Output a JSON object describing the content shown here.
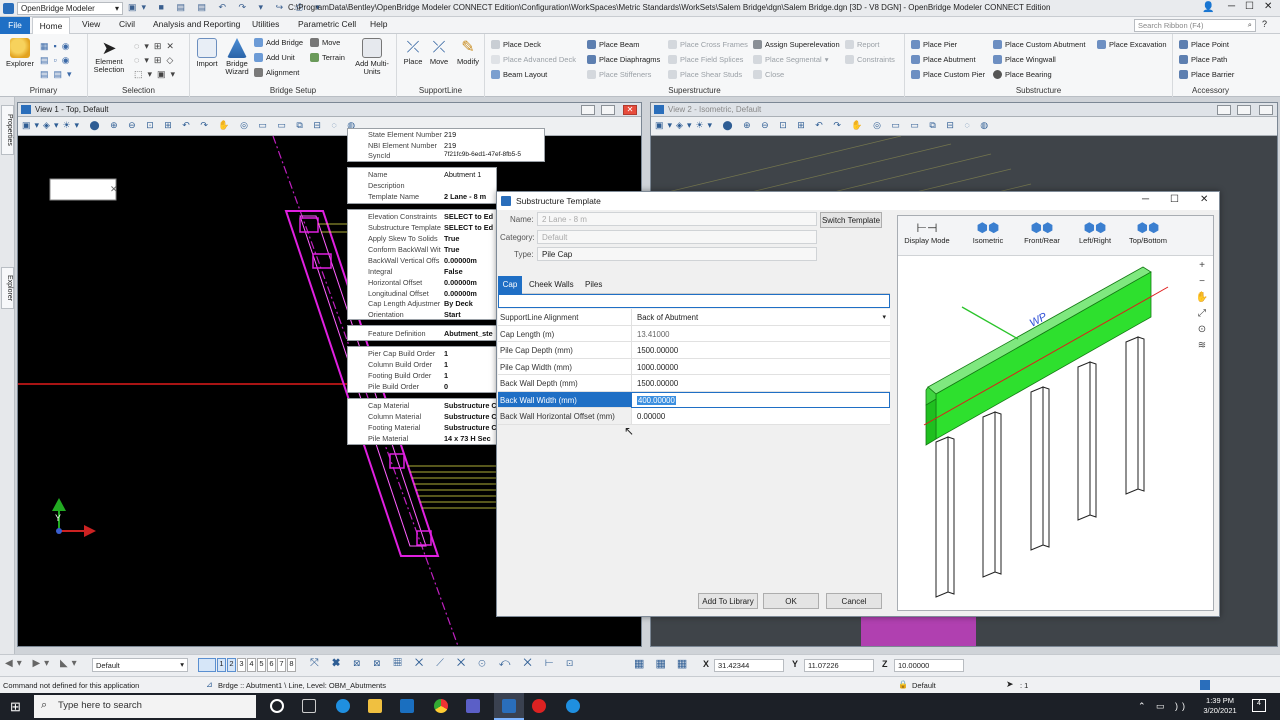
{
  "app": {
    "workflow": "OpenBridge Modeler",
    "title": "C:\\ProgramData\\Bentley\\OpenBridge Modeler CONNECT Edition\\Configuration\\WorkSpaces\\Metric Standards\\WorkSets\\Salem Bridge\\dgn\\Salem Bridge.dgn [3D - V8 DGN] - OpenBridge Modeler CONNECT Edition",
    "search_placeholder": "Search Ribbon (F4)"
  },
  "menu_tabs": [
    "File",
    "Home",
    "View",
    "Civil",
    "Analysis and Reporting",
    "Utilities",
    "Parametric Cell",
    "Help"
  ],
  "ribbon": {
    "primary": {
      "label": "Primary",
      "explorer": "Explorer"
    },
    "selection": {
      "label": "Selection",
      "element_selection": "Element Selection"
    },
    "bridge_setup": {
      "label": "Bridge Setup",
      "import": "Import",
      "bridge_wizard": "Bridge Wizard",
      "add_bridge": "Add Bridge",
      "add_unit": "Add Unit",
      "alignment": "Alignment",
      "move": "Move",
      "terrain": "Terrain",
      "add_multi_units": "Add Multi-Units"
    },
    "supportline": {
      "label": "SupportLine",
      "place": "Place",
      "move": "Move",
      "modify": "Modify"
    },
    "superstructure": {
      "label": "Superstructure",
      "place_deck": "Place Deck",
      "place_advanced_deck": "Place Advanced Deck",
      "beam_layout": "Beam Layout",
      "place_beam": "Place Beam",
      "place_diaphragms": "Place Diaphragms",
      "place_stiffeners": "Place Stiffeners",
      "place_cross_frames": "Place Cross Frames",
      "place_field_splices": "Place Field Splices",
      "place_shear_studs": "Place Shear Studs",
      "assign_superelevation": "Assign Superelevation",
      "place_segmental": "Place Segmental",
      "close": "Close",
      "report": "Report",
      "constraints": "Constraints"
    },
    "substructure": {
      "label": "Substructure",
      "place_pier": "Place Pier",
      "place_abutment": "Place Abutment",
      "place_custom_pier": "Place Custom Pier",
      "place_custom_abutment": "Place Custom Abutment",
      "place_wingwall": "Place Wingwall",
      "place_bearing": "Place Bearing",
      "place_excavation": "Place Excavation"
    },
    "accessory": {
      "label": "Accessory",
      "place_point": "Place Point",
      "place_path": "Place Path",
      "place_barrier": "Place Barrier"
    }
  },
  "side_tabs": [
    "Properties",
    "Explorer"
  ],
  "view1": {
    "title": "View 1 - Top, Default"
  },
  "view2": {
    "title": "View 2 - Isometric, Default"
  },
  "properties": {
    "group1": [
      [
        "State Element Number",
        "219"
      ],
      [
        "NBI Element Number",
        "219"
      ],
      [
        "SyncId",
        "7f21fc9b-6ed1-47ef-8fb5-5"
      ]
    ],
    "group2": [
      [
        "Name",
        "Abutment 1"
      ],
      [
        "Description",
        ""
      ],
      [
        "Template Name",
        "2 Lane - 8 m"
      ]
    ],
    "group3": [
      [
        "Elevation Constraints",
        "SELECT to Ed"
      ],
      [
        "Substructure Template",
        "SELECT to Ed"
      ],
      [
        "Apply Skew To Solids",
        "True"
      ],
      [
        "Conform BackWall Wit",
        "True"
      ],
      [
        "BackWall Vertical Offs",
        "0.00000m"
      ],
      [
        "Integral",
        "False"
      ],
      [
        "Horizontal Offset",
        "0.00000m"
      ],
      [
        "Longitudinal Offset",
        "0.00000m"
      ],
      [
        "Cap Length Adjustmer",
        "By Deck"
      ],
      [
        "Orientation",
        "Start"
      ]
    ],
    "group4": [
      [
        "Feature Definition",
        "Abutment_ste"
      ]
    ],
    "group5": [
      [
        "Pier Cap Build Order",
        "1"
      ],
      [
        "Column Build Order",
        "1"
      ],
      [
        "Footing Build Order",
        "1"
      ],
      [
        "Pile Build Order",
        "0"
      ]
    ],
    "group6": [
      [
        "Cap Material",
        "Substructure C"
      ],
      [
        "Column Material",
        "Substructure C"
      ],
      [
        "Footing Material",
        "Substructure C"
      ],
      [
        "Pile Material",
        "14 x 73 H Sec"
      ]
    ]
  },
  "dialog": {
    "title": "Substructure Template",
    "name_label": "Name:",
    "name_value": "2 Lane - 8 m",
    "category_label": "Category:",
    "category_value": "Default",
    "type_label": "Type:",
    "type_value": "Pile Cap",
    "switch_template": "Switch Template",
    "tabs": [
      "Cap",
      "Cheek Walls",
      "Piles"
    ],
    "rows": [
      [
        "SupportLine Alignment",
        "Back of Abutment"
      ],
      [
        "Cap Length (m)",
        "13.41000"
      ],
      [
        "Pile Cap Depth (mm)",
        "1500.00000"
      ],
      [
        "Pile Cap Width (mm)",
        "1000.00000"
      ],
      [
        "Back Wall Depth (mm)",
        "1500.00000"
      ],
      [
        "Back Wall Width (mm)",
        "400.00000"
      ],
      [
        "Back Wall Horizontal Offset (mm)",
        "0.00000"
      ]
    ],
    "selected_row": 5,
    "add_to_library": "Add To Library",
    "ok": "OK",
    "cancel": "Cancel",
    "preview": {
      "display_mode": "Display Mode",
      "isometric": "Isometric",
      "front_rear": "Front/Rear",
      "left_right": "Left/Right",
      "top_bottom": "Top/Bottom",
      "wp_label": "WP"
    }
  },
  "bottom_toolbar": {
    "level": "Default",
    "view_numbers": [
      "1",
      "2",
      "3",
      "4",
      "5",
      "6",
      "7",
      "8"
    ],
    "x_label": "X",
    "x_value": "31.42344",
    "y_label": "Y",
    "y_value": "11.07226",
    "z_label": "Z",
    "z_value": "10.00000"
  },
  "status": {
    "message": "Command not defined for this application",
    "element": "Brdge :: Abutment1 \\ Line, Level: OBM_Abutments",
    "level": "Default",
    "scale": ": 1"
  },
  "taskbar": {
    "search": "Type here to search",
    "time": "1:39 PM",
    "date": "3/20/2021"
  }
}
